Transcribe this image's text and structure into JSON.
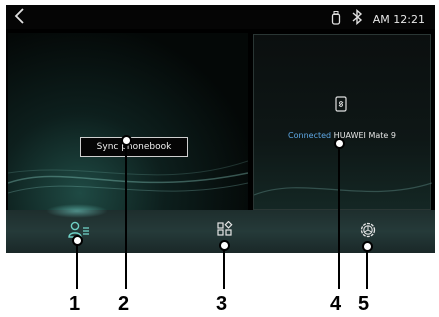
{
  "statusbar": {
    "time": "AM 12:21",
    "icons": [
      "back-chevron-icon",
      "usb-icon",
      "bluetooth-icon"
    ]
  },
  "left_panel": {
    "sync_button_label": "Sync phonebook"
  },
  "right_panel": {
    "connected_label": "Connected",
    "device_name": "HUAWEI Mate 9",
    "icon": "phone-link-icon"
  },
  "bottom_bar": {
    "items": [
      {
        "icon": "contacts-icon",
        "active": true
      },
      {
        "icon": "apps-grid-icon",
        "active": false
      },
      {
        "icon": "settings-gear-icon",
        "active": false
      }
    ]
  },
  "callouts": [
    "1",
    "2",
    "3",
    "4",
    "5"
  ],
  "colors": {
    "connected_text": "#5fa8e6",
    "accent": "#78dcd2"
  }
}
